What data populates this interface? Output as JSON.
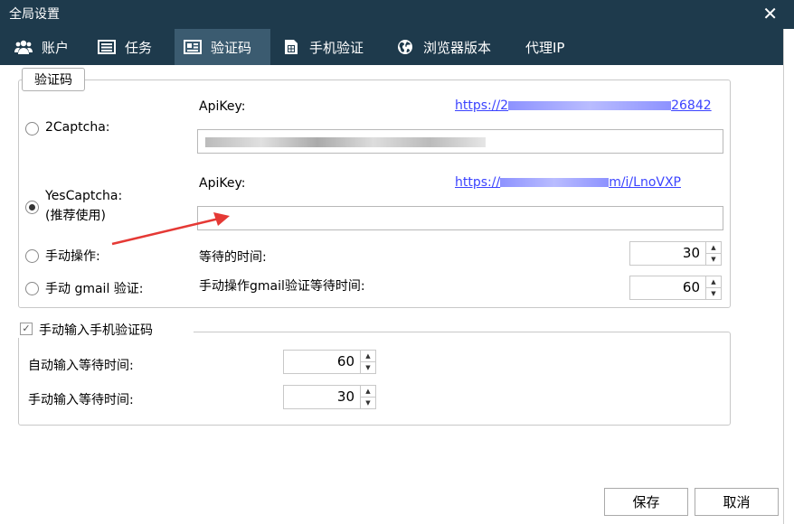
{
  "window": {
    "title": "全局设置",
    "close_glyph": "✕"
  },
  "tabs": [
    {
      "label": "账户",
      "icon": "users-icon"
    },
    {
      "label": "任务",
      "icon": "task-list-icon"
    },
    {
      "label": "验证码",
      "icon": "id-card-icon",
      "active": true
    },
    {
      "label": "手机验证",
      "icon": "phone-sim-icon"
    },
    {
      "label": "浏览器版本",
      "icon": "globe-icon"
    },
    {
      "label": "代理IP",
      "icon": ""
    }
  ],
  "captcha_group": {
    "legend": "验证码",
    "twocaptcha": {
      "label": "2Captcha:",
      "apikey_label": "ApiKey:",
      "link_visible": "https://2",
      "link_tail": "26842",
      "selected": false
    },
    "yescaptcha": {
      "label_line1": "YesCaptcha:",
      "label_line2": "(推荐使用)",
      "apikey_label": "ApiKey:",
      "link_visible": "https://",
      "link_tail": "m/i/LnoVXP",
      "apikey_value": "",
      "selected": true
    },
    "manual": {
      "label": "手动操作:",
      "wait_label": "等待的时间:",
      "wait_value": "30",
      "selected": false
    },
    "manual_gmail": {
      "label": "手动 gmail 验证:",
      "wait_label": "手动操作gmail验证等待时间:",
      "wait_value": "60",
      "selected": false
    }
  },
  "phone_group": {
    "checkbox_label": "手动输入手机验证码",
    "checked": true,
    "check_glyph": "✓",
    "auto_wait_label": "自动输入等待时间:",
    "auto_wait_value": "60",
    "manual_wait_label": "手动输入等待时间:",
    "manual_wait_value": "30"
  },
  "buttons": {
    "save": "保存",
    "cancel": "取消"
  },
  "spin_glyphs": {
    "up": "▲",
    "down": "▼"
  },
  "colors": {
    "titlebar": "#1e3a4c",
    "active_tab": "#3b5b70",
    "link": "#3b43ff",
    "annotation_arrow": "#e53935"
  }
}
